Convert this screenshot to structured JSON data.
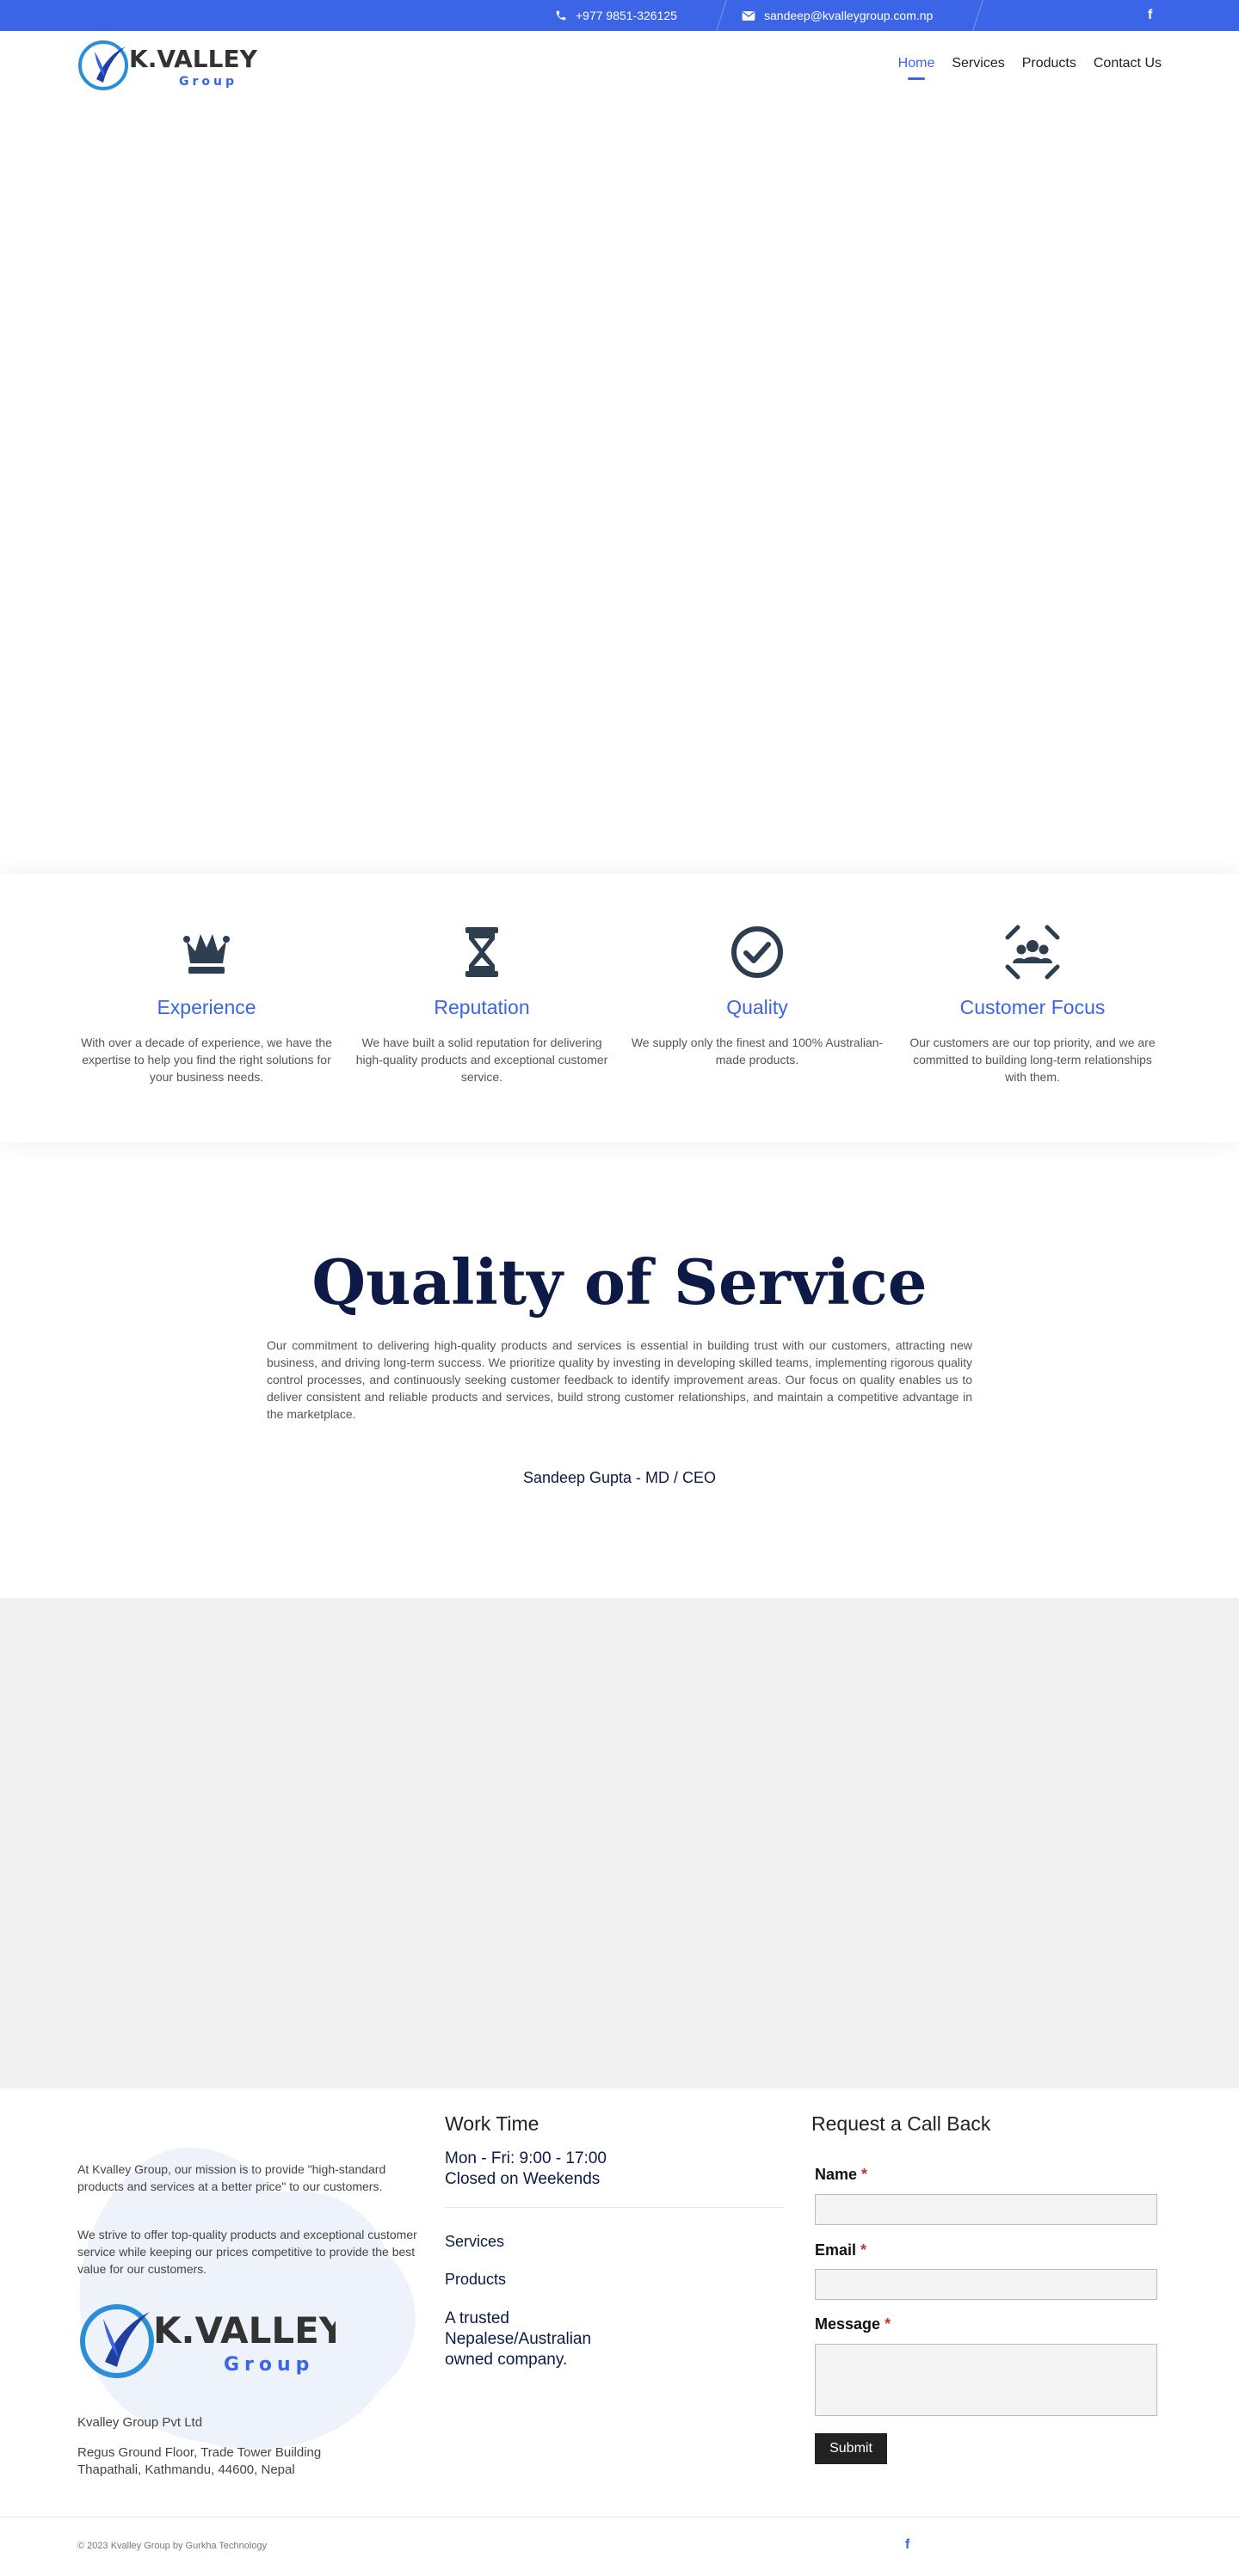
{
  "topbar": {
    "phone": "+977 9851-326125",
    "email": "sandeep@kvalleygroup.com.np",
    "social_icon": "facebook-icon",
    "background": "#3c64e6"
  },
  "brand": {
    "name": "K.VALLEY",
    "sub": "Group",
    "text_color": "#333333",
    "accent": "#3c64e6"
  },
  "nav": {
    "items": [
      "Home",
      "Services",
      "Products",
      "Contact Us"
    ],
    "active": "Home"
  },
  "features": [
    {
      "icon": "chess-queen-icon",
      "title": "Experience",
      "text": "With over a decade of experience, we have the expertise to help you find the right solutions for your business needs."
    },
    {
      "icon": "hourglass-icon",
      "title": "Reputation",
      "text": "We have built a solid reputation for delivering high-quality products and exceptional customer service."
    },
    {
      "icon": "check-circle-icon",
      "title": "Quality",
      "text": "We supply only the finest and 100% Australian-made products."
    },
    {
      "icon": "users-focus-icon",
      "title": "Customer Focus",
      "text": "Our customers are our top priority, and we are committed to building long-term relationships with them."
    }
  ],
  "quality": {
    "title": "Quality of Service",
    "text": "Our commitment to delivering high-quality products and services is essential in building trust with our customers, attracting new business, and driving long-term success. We prioritize quality by investing in developing skilled teams, implementing rigorous quality control processes, and continuously seeking customer feedback to identify improvement areas. Our focus on quality enables us to deliver consistent and reliable products and services, build strong customer relationships, and maintain a competitive advantage in the marketplace.",
    "signature": "Sandeep Gupta - MD / CEO"
  },
  "footer": {
    "about_p1": "At Kvalley Group, our mission is to provide \"high-standard products and services at a better price\" to our customers.",
    "about_p2": "We strive to offer top-quality products and exceptional customer service while keeping our prices competitive to provide the best value for our customers.",
    "company": "Kvalley Group Pvt Ltd",
    "address": "Regus Ground Floor, Trade Tower Building Thapathali, Kathmandu, 44600, Nepal",
    "worktime_title": "Work Time",
    "hours_line1": "Mon - Fri: 9:00 - 17:00",
    "hours_line2": "Closed on Weekends",
    "links": [
      "Services",
      "Products"
    ],
    "tagline": "A trusted Nepalese/Australian owned company.",
    "callback_title": "Request a Call Back",
    "form": {
      "name_label": "Name",
      "email_label": "Email",
      "message_label": "Message",
      "required_mark": "*",
      "submit": "Submit"
    },
    "copyright": "© 2023 Kvalley Group by Gurkha Technology"
  }
}
